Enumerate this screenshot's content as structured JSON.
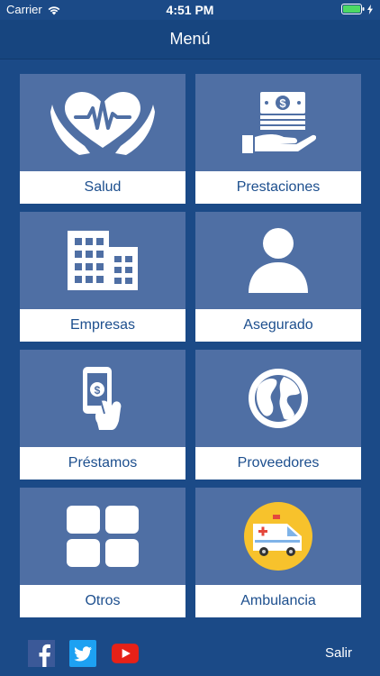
{
  "status": {
    "carrier": "Carrier",
    "time": "4:51 PM"
  },
  "header": {
    "title": "Menú"
  },
  "menu": [
    {
      "label": "Salud",
      "icon": "health-heart-hands-icon"
    },
    {
      "label": "Prestaciones",
      "icon": "money-hand-icon"
    },
    {
      "label": "Empresas",
      "icon": "building-icon"
    },
    {
      "label": "Asegurado",
      "icon": "user-icon"
    },
    {
      "label": "Préstamos",
      "icon": "phone-payment-icon"
    },
    {
      "label": "Proveedores",
      "icon": "globe-icon"
    },
    {
      "label": "Otros",
      "icon": "grid-icon"
    },
    {
      "label": "Ambulancia",
      "icon": "ambulance-icon"
    }
  ],
  "footer": {
    "logout_label": "Salir"
  },
  "colors": {
    "background": "#1b4a87",
    "tile": "#4f6fa4",
    "label_text": "#1d4f8e",
    "ambulance_circle": "#f7c22c"
  }
}
